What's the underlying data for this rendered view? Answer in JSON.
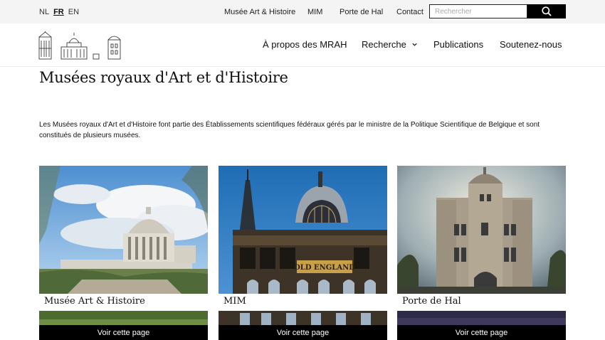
{
  "languages": [
    {
      "code": "NL",
      "active": false
    },
    {
      "code": "FR",
      "active": true
    },
    {
      "code": "EN",
      "active": false
    }
  ],
  "top_links": [
    "Musée Art & Histoire",
    "MIM",
    "Porte de Hal",
    "Contact"
  ],
  "search": {
    "placeholder": "Rechercher",
    "value": ""
  },
  "main_nav": [
    "À propos des MRAH",
    "Recherche",
    "Publications",
    "Soutenez-nous"
  ],
  "page_title": "Musées royaux d'Art et d'Histoire",
  "intro": "Les Musées royaux d'Art et d'Histoire font partie des Établissements scientifiques fédéraux gérés par le ministre de la Politique Scientifique de Belgique et sont constitués de plusieurs musées.",
  "cards": [
    {
      "title": "Musée Art & Histoire",
      "button": "Voir cette page"
    },
    {
      "title": "MIM",
      "button": "Voir cette page"
    },
    {
      "title": "Porte de Hal",
      "button": "Voir cette page"
    }
  ],
  "mim_sign": "OLD ENGLAND",
  "icons": [
    "search-icon",
    "chevron-down-icon",
    "museum-logo"
  ]
}
